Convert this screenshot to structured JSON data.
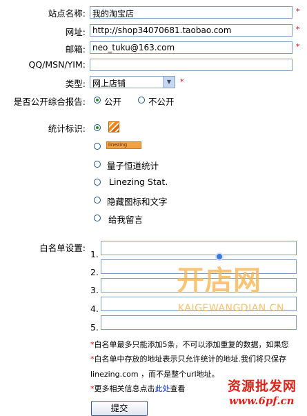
{
  "form": {
    "site_name": {
      "label": "站点名称:",
      "value": "我的淘宝店",
      "required": "*"
    },
    "url": {
      "label": "网址:",
      "value": "http://shop34070681.taobao.com",
      "required": "*"
    },
    "email": {
      "label": "邮箱:",
      "value": "neo_tuku@163.com",
      "required": "*"
    },
    "im": {
      "label": "QQ/MSN/YIM:",
      "value": ""
    },
    "type": {
      "label": "类型:",
      "value": "网上店铺",
      "required": "*"
    },
    "public_report": {
      "label": "是否公开综合报告:",
      "options": [
        {
          "label": "公开",
          "selected": true
        },
        {
          "label": "不公开",
          "selected": false
        }
      ]
    },
    "stat_icon": {
      "label": "统计标识:",
      "options": [
        {
          "label": "",
          "icon": "stat-bars-icon",
          "selected": true
        },
        {
          "label": "linezing",
          "icon": "linezing-badge-icon",
          "selected": false
        },
        {
          "label": "量子恒道统计",
          "selected": false
        },
        {
          "label": "Linezing Stat.",
          "selected": false
        },
        {
          "label": "隐藏图标和文字",
          "selected": false
        },
        {
          "label": "给我留言",
          "selected": false
        }
      ]
    },
    "whitelist": {
      "label": "白名单设置:",
      "items": [
        {
          "num": "1.",
          "value": ""
        },
        {
          "num": "2.",
          "value": ""
        },
        {
          "num": "3.",
          "value": ""
        },
        {
          "num": "4.",
          "value": ""
        },
        {
          "num": "5.",
          "value": ""
        }
      ]
    },
    "notes": {
      "n1": "白名单最多只能添加5条，不可以添加重复的数据，如果您",
      "n2a": "白名单中存放的地址表示只允许统计的地址.我们将只保存",
      "n2b": "linezing.com ，而不是整个url地址。",
      "n3_prefix": "更多相关信息点击",
      "n3_link": "此处",
      "n3_suffix": "查看",
      "star": "*"
    },
    "submit_label": "提交"
  },
  "watermark": {
    "logo_text": "开店网",
    "domain": "KAIGEWANGDIAN.CN",
    "bottom_title": "资源批发网",
    "bottom_url": "www.6pf.cn"
  },
  "colors": {
    "required": "#ee0000",
    "link": "#0033cc",
    "watermark": "#f6b24a"
  }
}
